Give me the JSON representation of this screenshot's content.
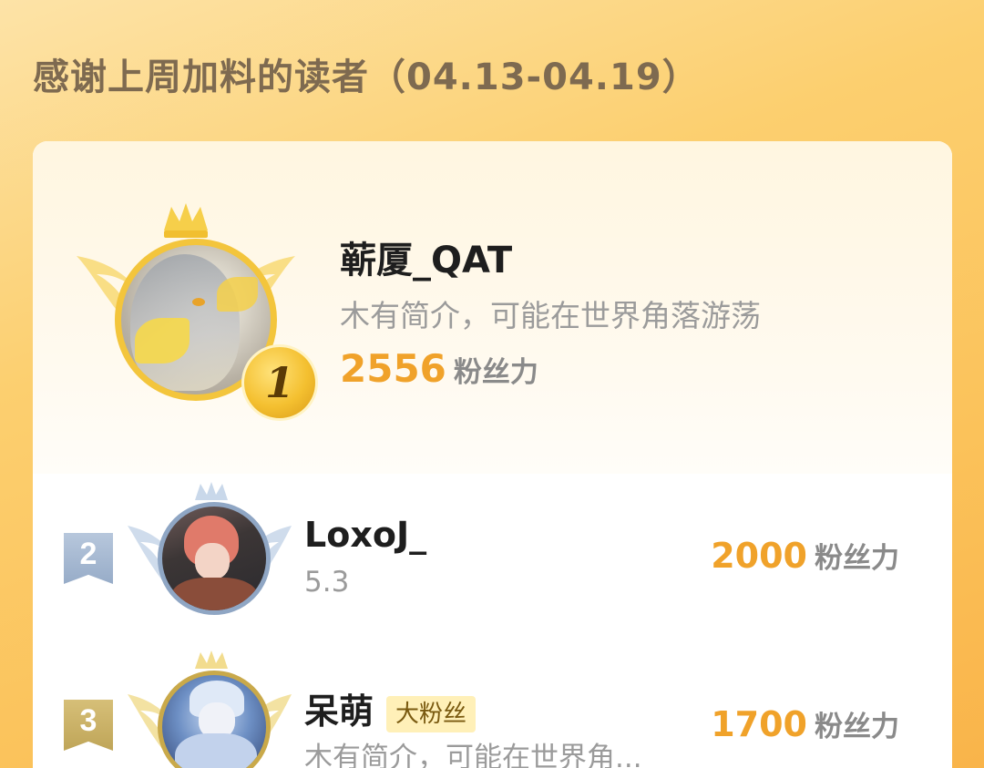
{
  "header": {
    "title": "感谢上周加料的读者（04.13-04.19）"
  },
  "leaderboard": [
    {
      "rank": "1",
      "name": "蕲厦_QAT",
      "bio": "木有简介，可能在世界角落游荡",
      "score": "2556",
      "score_unit": "粉丝力",
      "avatar_icon": "anime-avatar-gold"
    },
    {
      "rank": "2",
      "name": "LoxoJ_",
      "bio": "5.3",
      "score": "2000",
      "score_unit": "粉丝力",
      "avatar_icon": "anime-avatar-silver"
    },
    {
      "rank": "3",
      "name": "呆萌",
      "badge": "大粉丝",
      "bio": "木有简介，可能在世界角...",
      "score": "1700",
      "score_unit": "粉丝力",
      "avatar_icon": "anime-avatar-bronze"
    }
  ],
  "colors": {
    "accent": "#f0a22a",
    "gold": "#f3c53c",
    "silver": "#a9bcd6",
    "bronze": "#c8aa5a"
  }
}
